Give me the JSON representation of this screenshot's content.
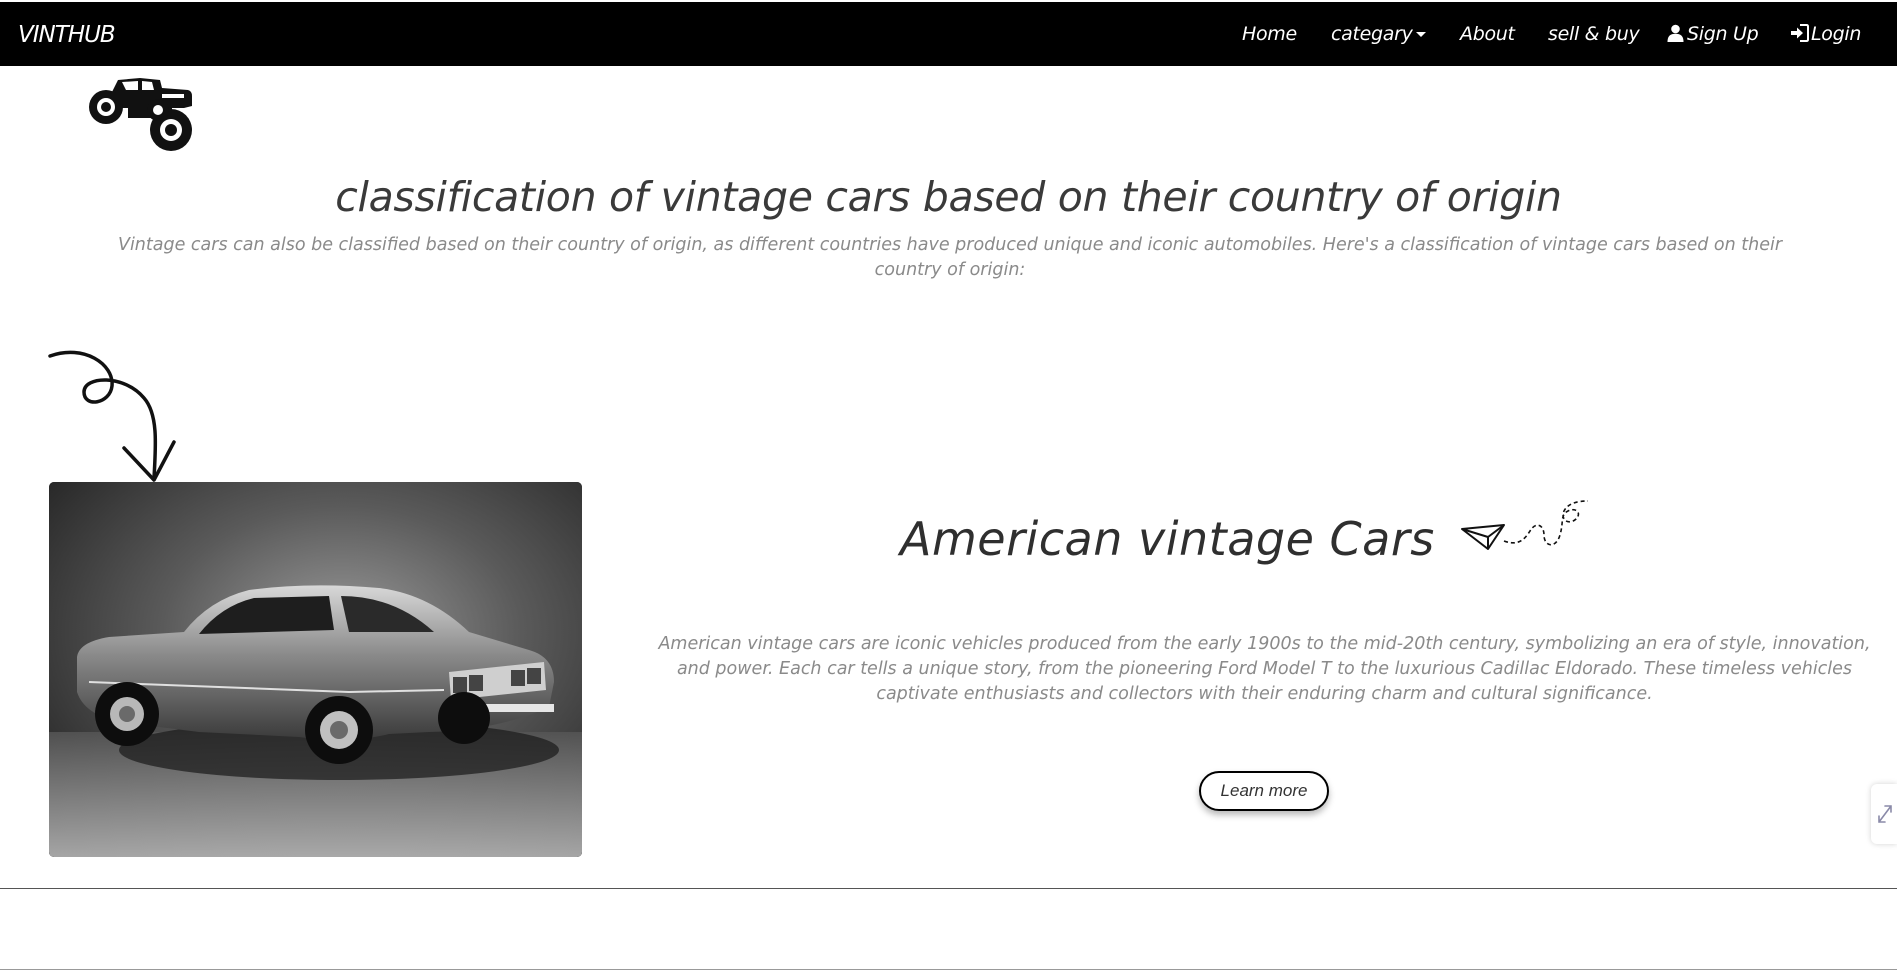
{
  "navbar": {
    "brand": "VINTHUB",
    "items": [
      {
        "label": "Home"
      },
      {
        "label": "categary",
        "icon": "caret-down-icon"
      },
      {
        "label": "About"
      },
      {
        "label": "sell & buy"
      },
      {
        "label": "Sign Up",
        "icon": "user-icon"
      },
      {
        "label": "Login",
        "icon": "login-icon"
      }
    ]
  },
  "page": {
    "title": "classification of vintage cars based on their country of origin",
    "intro": "Vintage cars can also be classified based on their country of origin, as different countries have produced unique and iconic automobiles. Here's a classification of vintage cars based on their country of origin:"
  },
  "section": {
    "title": "American vintage Cars",
    "description": "American vintage cars are iconic vehicles produced from the early 1900s to the mid-20th century, symbolizing an era of style, innovation, and power. Each car tells a unique story, from the pioneering Ford Model T to the luxurious Cadillac Eldorado. These timeless vehicles captivate enthusiasts and collectors with their enduring charm and cultural significance.",
    "button_label": "Learn more",
    "image": "black-and-white-vintage-coupe-photo"
  },
  "icons": {
    "logo": "monster-truck-icon",
    "arrow": "curly-arrow-icon",
    "plane": "paper-plane-icon"
  },
  "colors": {
    "navbar_bg": "#000000",
    "navbar_text": "#ffffff",
    "heading": "#333333",
    "muted_text": "#8a8a8a"
  }
}
